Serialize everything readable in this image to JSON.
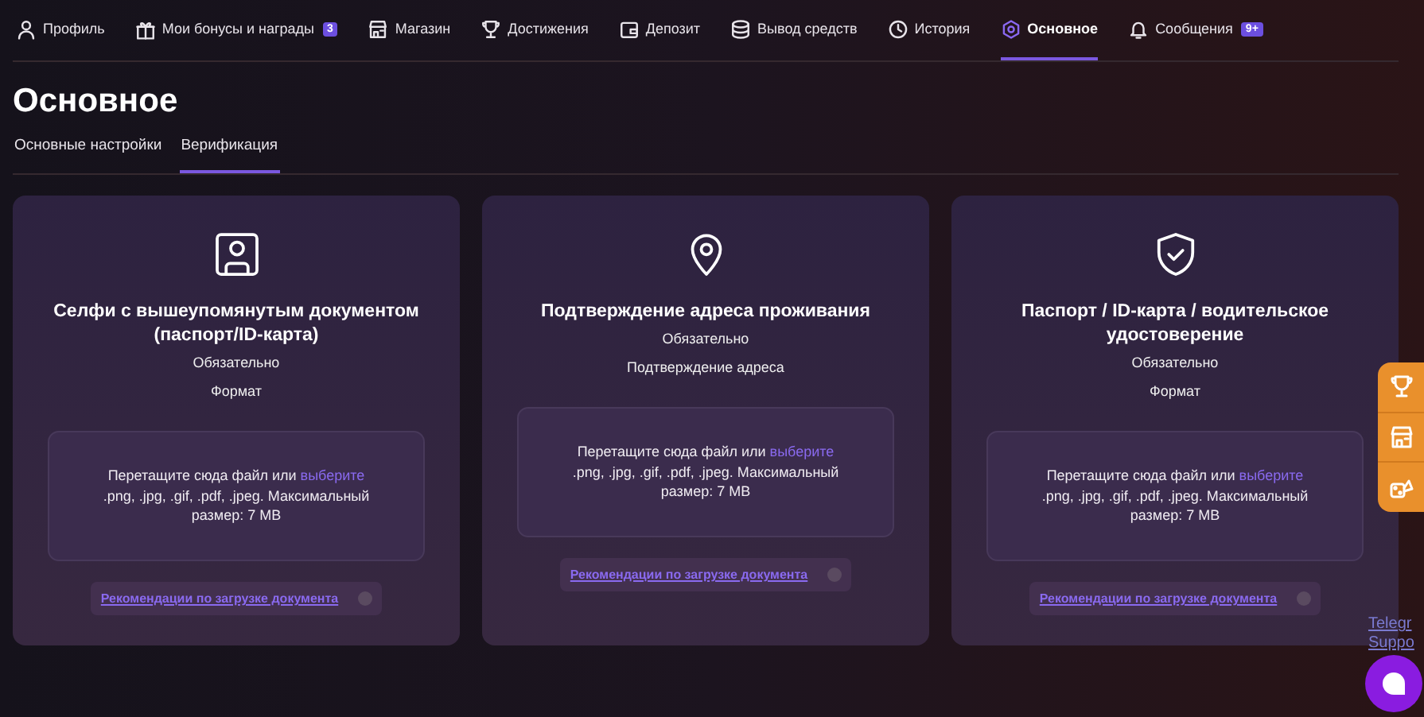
{
  "nav": [
    {
      "label": "Профиль",
      "selected": false
    },
    {
      "label": "Мои бонусы и награды",
      "badge": "3",
      "selected": false
    },
    {
      "label": "Магазин",
      "selected": false
    },
    {
      "label": "Достижения",
      "selected": false
    },
    {
      "label": "Депозит",
      "selected": false
    },
    {
      "label": "Вывод средств",
      "selected": false
    },
    {
      "label": "История",
      "selected": false
    },
    {
      "label": "Основное",
      "selected": true
    },
    {
      "label": "Сообщения",
      "badge": "9+",
      "selected": false
    }
  ],
  "page_title": "Основное",
  "tabs": [
    {
      "label": "Основные настройки",
      "selected": false
    },
    {
      "label": "Верификация",
      "selected": true
    }
  ],
  "cards": [
    {
      "title": "Селфи с вышеупомянутым документом (паспорт/ID-карта)",
      "required": "Обязательно",
      "note": "Формат",
      "drop_before": "Перетащите сюда файл или",
      "drop_link": "выберите",
      "drop_after": ".png, .jpg, .gif, .pdf, .jpeg. Максимальный размер: 7 MB",
      "guide": "Рекомендации по загрузке документа"
    },
    {
      "title": "Подтверждение адреса проживания",
      "required": "Обязательно",
      "note": "Подтверждение адреса",
      "drop_before": "Перетащите сюда файл или",
      "drop_link": "выберите",
      "drop_after": ".png, .jpg, .gif, .pdf, .jpeg. Максимальный размер: 7 MB",
      "guide": "Рекомендации по загрузке документа"
    },
    {
      "title": "Паспорт / ID-карта / водительское удостоверение",
      "required": "Обязательно",
      "note": "Формат",
      "drop_before": "Перетащите сюда файл или",
      "drop_link": "выберите",
      "drop_after": ".png, .jpg, .gif, .pdf, .jpeg. Максимальный размер: 7 MB",
      "guide": "Рекомендации по загрузке документа"
    }
  ],
  "telegram_link": [
    "Telegr",
    "Suppo"
  ]
}
